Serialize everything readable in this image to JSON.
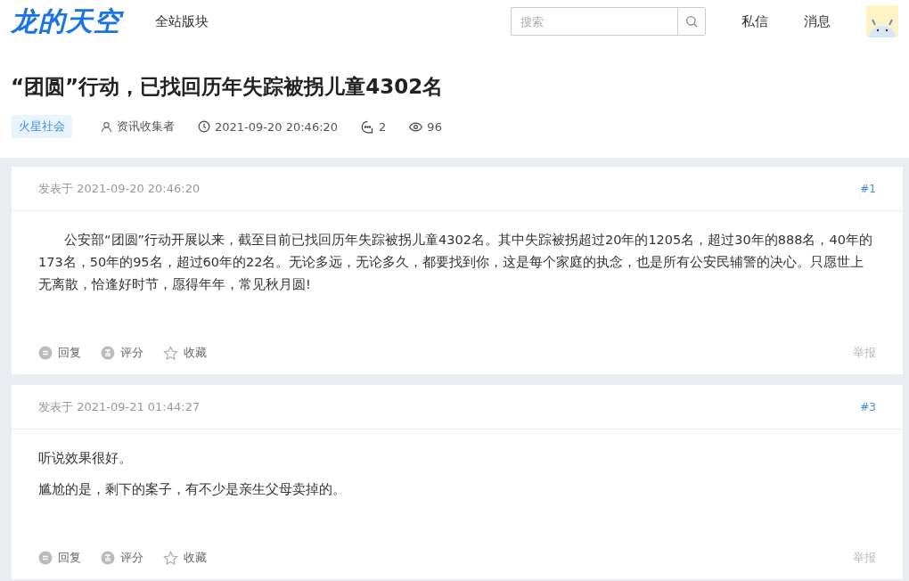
{
  "header": {
    "logo": "龙的天空",
    "nav": "全站版块",
    "search": {
      "placeholder": "搜索"
    },
    "links": [
      "私信",
      "消息"
    ]
  },
  "thread": {
    "title": "“团圆”行动，已找回历年失踪被拐儿童4302名",
    "tag": "火星社会",
    "author": "资讯收集者",
    "time": "2021-09-20 20:46:20",
    "replies": "2",
    "views": "96"
  },
  "posts": [
    {
      "posted": "发表于 2021-09-20 20:46:20",
      "floor": "#1",
      "indent": true,
      "paragraphs": [
        "公安部“团圆”行动开展以来，截至目前已找回历年失踪被拐儿童4302名。其中失踪被拐超过20年的1205名，超过30年的888名，40年的173名，50年的95名，超过60年的22名。无论多远，无论多久，都要找到你，这是每个家庭的执念，也是所有公安民辅警的决心。只愿世上无离散，恰逢好时节，愿得年年，常见秋月圆!"
      ],
      "actions": [
        {
          "kind": "reply",
          "label": "回复"
        },
        {
          "kind": "rate",
          "label": "评分"
        },
        {
          "kind": "favorite",
          "label": "收藏"
        }
      ],
      "report": "举报"
    },
    {
      "posted": "发表于 2021-09-21 01:44:27",
      "floor": "#3",
      "indent": false,
      "paragraphs": [
        "听说效果很好。",
        "尴尬的是，剩下的案子，有不少是亲生父母卖掉的。"
      ],
      "actions": [
        {
          "kind": "reply",
          "label": "回复"
        },
        {
          "kind": "rate",
          "label": "评分"
        },
        {
          "kind": "favorite",
          "label": "收藏"
        }
      ],
      "report": "举报"
    }
  ]
}
